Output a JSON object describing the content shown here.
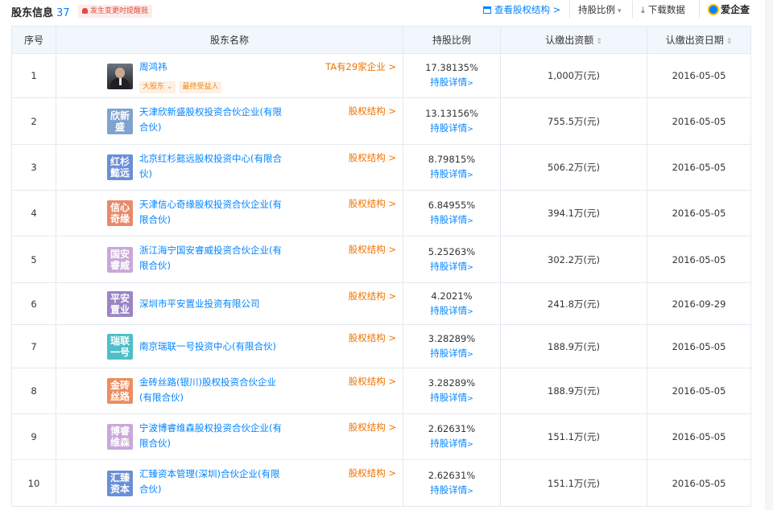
{
  "header": {
    "title": "股东信息",
    "count": "37",
    "alert_label": "发生变更时提醒我",
    "view_structure": "查看股权结构 >",
    "sort_label": "持股比例",
    "download_label": "下载数据",
    "brand": "爱企查"
  },
  "table": {
    "columns": [
      "序号",
      "股东名称",
      "持股比例",
      "认缴出资额",
      "认缴出资日期"
    ],
    "rows": [
      {
        "idx": "1",
        "name": "周鸿祎",
        "tags": [
          "大股东",
          "最终受益人"
        ],
        "right_link": "TA有29家企业 >",
        "pct": "17.38135%",
        "detail": "持股详情",
        "amount": "1,000万(元)",
        "date": "2016-05-05"
      },
      {
        "idx": "2",
        "logo": [
          "欣新",
          "盛"
        ],
        "logo_color": "#7fa3cf",
        "name_lines": [
          "天津欣新盛股权投资合伙企业(有限",
          "合伙)"
        ],
        "right_link": "股权结构 >",
        "pct": "13.13156%",
        "detail": "持股详情",
        "amount": "755.5万(元)",
        "date": "2016-05-05"
      },
      {
        "idx": "3",
        "logo": [
          "红杉",
          "懿远"
        ],
        "logo_color": "#6a8fd6",
        "name_lines": [
          "北京红杉懿远股权投资中心(有限合",
          "伙)"
        ],
        "right_link": "股权结构 >",
        "pct": "8.79815%",
        "detail": "持股详情",
        "amount": "506.2万(元)",
        "date": "2016-05-05"
      },
      {
        "idx": "4",
        "logo": [
          "信心",
          "奇缘"
        ],
        "logo_color": "#e88a6a",
        "name_lines": [
          "天津信心奇缘股权投资合伙企业(有",
          "限合伙)"
        ],
        "right_link": "股权结构 >",
        "pct": "6.84955%",
        "detail": "持股详情",
        "amount": "394.1万(元)",
        "date": "2016-05-05"
      },
      {
        "idx": "5",
        "logo": [
          "国安",
          "睿威"
        ],
        "logo_color": "#c9a8d8",
        "name_lines": [
          "浙江海宁国安睿威投资合伙企业(有",
          "限合伙)"
        ],
        "right_link": "股权结构 >",
        "pct": "5.25263%",
        "detail": "持股详情",
        "amount": "302.2万(元)",
        "date": "2016-05-05"
      },
      {
        "idx": "6",
        "logo": [
          "平安",
          "置业"
        ],
        "logo_color": "#9b84c6",
        "name_lines": [
          "深圳市平安置业投资有限公司"
        ],
        "right_link": "股权结构 >",
        "pct": "4.2021%",
        "detail": "持股详情",
        "amount": "241.8万(元)",
        "date": "2016-09-29"
      },
      {
        "idx": "7",
        "logo": [
          "瑞联",
          "一号"
        ],
        "logo_color": "#4dbfc8",
        "name_lines": [
          "南京瑞联一号投资中心(有限合伙)"
        ],
        "right_link": "股权结构 >",
        "pct": "3.28289%",
        "detail": "持股详情",
        "amount": "188.9万(元)",
        "date": "2016-05-05"
      },
      {
        "idx": "8",
        "logo": [
          "金砖",
          "丝路"
        ],
        "logo_color": "#ec8e62",
        "name_lines": [
          "金砖丝路(银川)股权投资合伙企业",
          "(有限合伙)"
        ],
        "right_link": "股权结构 >",
        "pct": "3.28289%",
        "detail": "持股详情",
        "amount": "188.9万(元)",
        "date": "2016-05-05"
      },
      {
        "idx": "9",
        "logo": [
          "博睿",
          "维森"
        ],
        "logo_color": "#c9a8d8",
        "name_lines": [
          "宁波博睿维森股权投资合伙企业(有",
          "限合伙)"
        ],
        "right_link": "股权结构 >",
        "pct": "2.62631%",
        "detail": "持股详情",
        "amount": "151.1万(元)",
        "date": "2016-05-05"
      },
      {
        "idx": "10",
        "logo": [
          "汇臻",
          "资本"
        ],
        "logo_color": "#6a8fd6",
        "name_lines": [
          "汇臻资本管理(深圳)合伙企业(有限",
          "合伙)"
        ],
        "right_link": "股权结构 >",
        "pct": "2.62631%",
        "detail": "持股详情",
        "amount": "151.1万(元)",
        "date": "2016-05-05"
      }
    ]
  }
}
